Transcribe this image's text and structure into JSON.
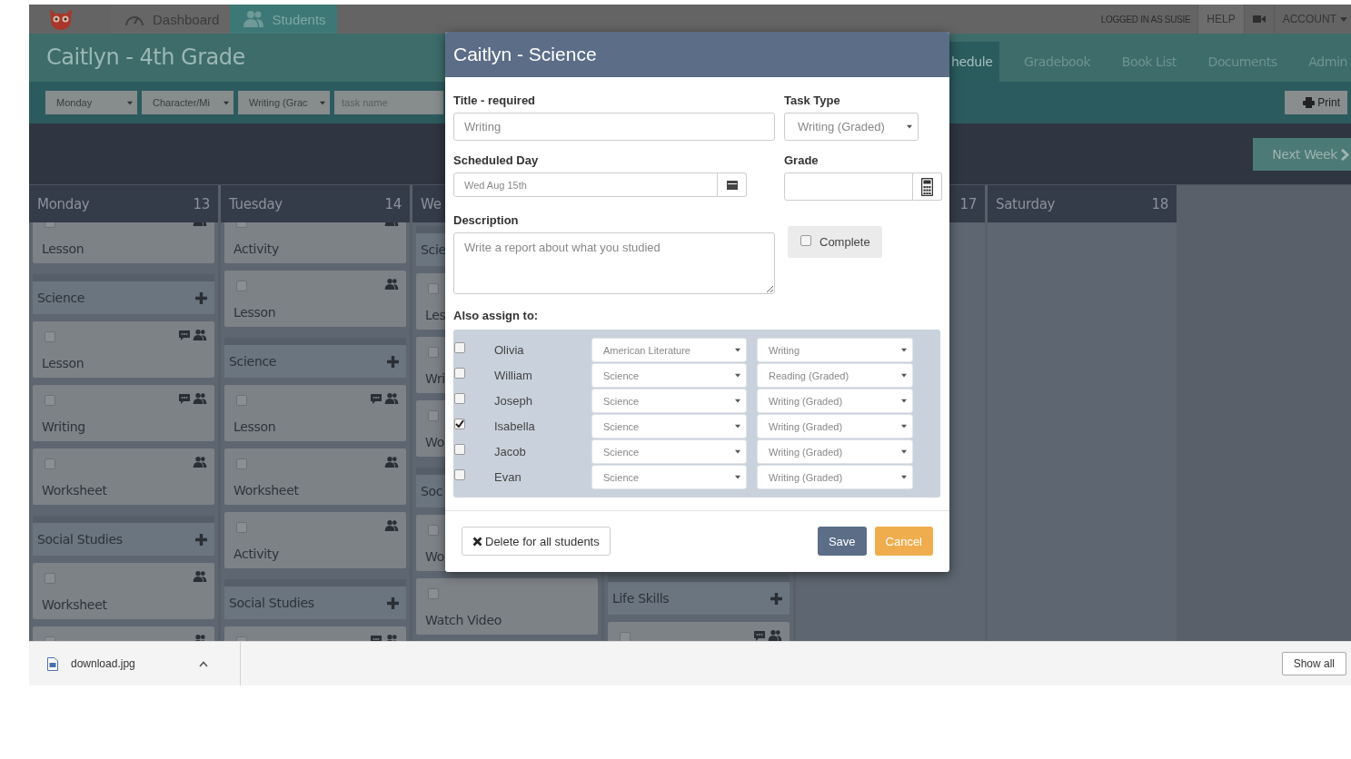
{
  "top_nav": {
    "tabs": [
      {
        "label": "Dashboard",
        "selected": false
      },
      {
        "label": "Students",
        "selected": true
      }
    ],
    "user_text": "LOGGED IN AS SUSIE",
    "help": "HELP",
    "account": "ACCOUNT"
  },
  "header": {
    "title": "Caitlyn - 4th Grade",
    "tabs": [
      {
        "label": "hedule",
        "selected": true
      },
      {
        "label": "Gradebook",
        "selected": false
      },
      {
        "label": "Book List",
        "selected": false
      },
      {
        "label": "Documents",
        "selected": false
      },
      {
        "label": "Admin",
        "selected": false
      }
    ]
  },
  "filters": {
    "selects": [
      "Monday",
      "Character/Mi",
      "Writing (Grac"
    ],
    "task_name": {
      "placeholder": "task name"
    },
    "print": "Print"
  },
  "next_week": "Next Week",
  "days": [
    {
      "name": "Monday",
      "date": "13",
      "items": [
        {
          "kind": "task",
          "label": "Lesson",
          "checked": false,
          "comment": false
        },
        {
          "kind": "section",
          "label": "Science"
        },
        {
          "kind": "task",
          "label": "Lesson",
          "checked": false,
          "comment": true
        },
        {
          "kind": "task",
          "label": "Writing",
          "checked": false,
          "comment": true
        },
        {
          "kind": "task",
          "label": "Worksheet",
          "checked": false,
          "comment": false
        },
        {
          "kind": "section",
          "label": "Social Studies"
        },
        {
          "kind": "task",
          "label": "Worksheet",
          "checked": false,
          "comment": false
        },
        {
          "kind": "task",
          "comment": false
        }
      ]
    },
    {
      "name": "Tuesday",
      "date": "14",
      "items": [
        {
          "kind": "task",
          "label": "Activity",
          "checked": false,
          "comment": false
        },
        {
          "kind": "task",
          "label": "Lesson",
          "checked": false,
          "comment": false
        },
        {
          "kind": "section",
          "label": "Science"
        },
        {
          "kind": "task",
          "label": "Lesson",
          "checked": false,
          "comment": true
        },
        {
          "kind": "task",
          "label": "Worksheet",
          "checked": false,
          "comment": false
        },
        {
          "kind": "task",
          "label": "Activity",
          "checked": false,
          "comment": false
        },
        {
          "kind": "section",
          "label": "Social Studies"
        },
        {
          "kind": "task",
          "comment": true
        }
      ]
    },
    {
      "name": "We",
      "items": [
        {
          "kind": "section",
          "label": "Scie"
        },
        {
          "kind": "task",
          "label": "Les",
          "checked": false
        },
        {
          "kind": "task",
          "label": "Wri",
          "checked": false
        },
        {
          "kind": "task",
          "label": "Wo",
          "checked": false
        },
        {
          "kind": "section",
          "label": "Soc"
        },
        {
          "kind": "task",
          "label": "Wo",
          "checked": false
        },
        {
          "kind": "task",
          "label": "Watch Video",
          "checked": false
        }
      ]
    },
    {
      "items": [
        {
          "kind": "section",
          "label": "Life Skills"
        },
        {
          "kind": "task",
          "checked": false,
          "comment": true
        }
      ]
    },
    {
      "date": "17"
    },
    {
      "name": "Saturday",
      "date": "18"
    }
  ],
  "modal": {
    "title": "Caitlyn - Science",
    "title_field": {
      "label": "Title - required",
      "value": "Writing"
    },
    "task_type": {
      "label": "Task Type",
      "value": "Writing (Graded)"
    },
    "scheduled_day": {
      "label": "Scheduled Day",
      "value": "Wed Aug 15th"
    },
    "grade": {
      "label": "Grade"
    },
    "description": {
      "label": "Description",
      "placeholder": "Write a report about what you studied"
    },
    "complete": {
      "label": "Complete",
      "checked": false
    },
    "assign_label": "Also assign to:",
    "students": [
      {
        "name": "Olivia",
        "checked": false,
        "subject": "American Literature",
        "task_type": "Writing"
      },
      {
        "name": "William",
        "checked": false,
        "subject": "Science",
        "task_type": "Reading (Graded)"
      },
      {
        "name": "Joseph",
        "checked": false,
        "subject": "Science",
        "task_type": "Writing (Graded)"
      },
      {
        "name": "Isabella",
        "checked": true,
        "subject": "Science",
        "task_type": "Writing (Graded)"
      },
      {
        "name": "Jacob",
        "checked": false,
        "subject": "Science",
        "task_type": "Writing (Graded)"
      },
      {
        "name": "Evan",
        "checked": false,
        "subject": "Science",
        "task_type": "Writing (Graded)"
      }
    ],
    "delete_button": "Delete for all students",
    "save_button": "Save",
    "cancel_button": "Cancel"
  },
  "download_bar": {
    "file": "download.jpg",
    "show_all": "Show all"
  }
}
